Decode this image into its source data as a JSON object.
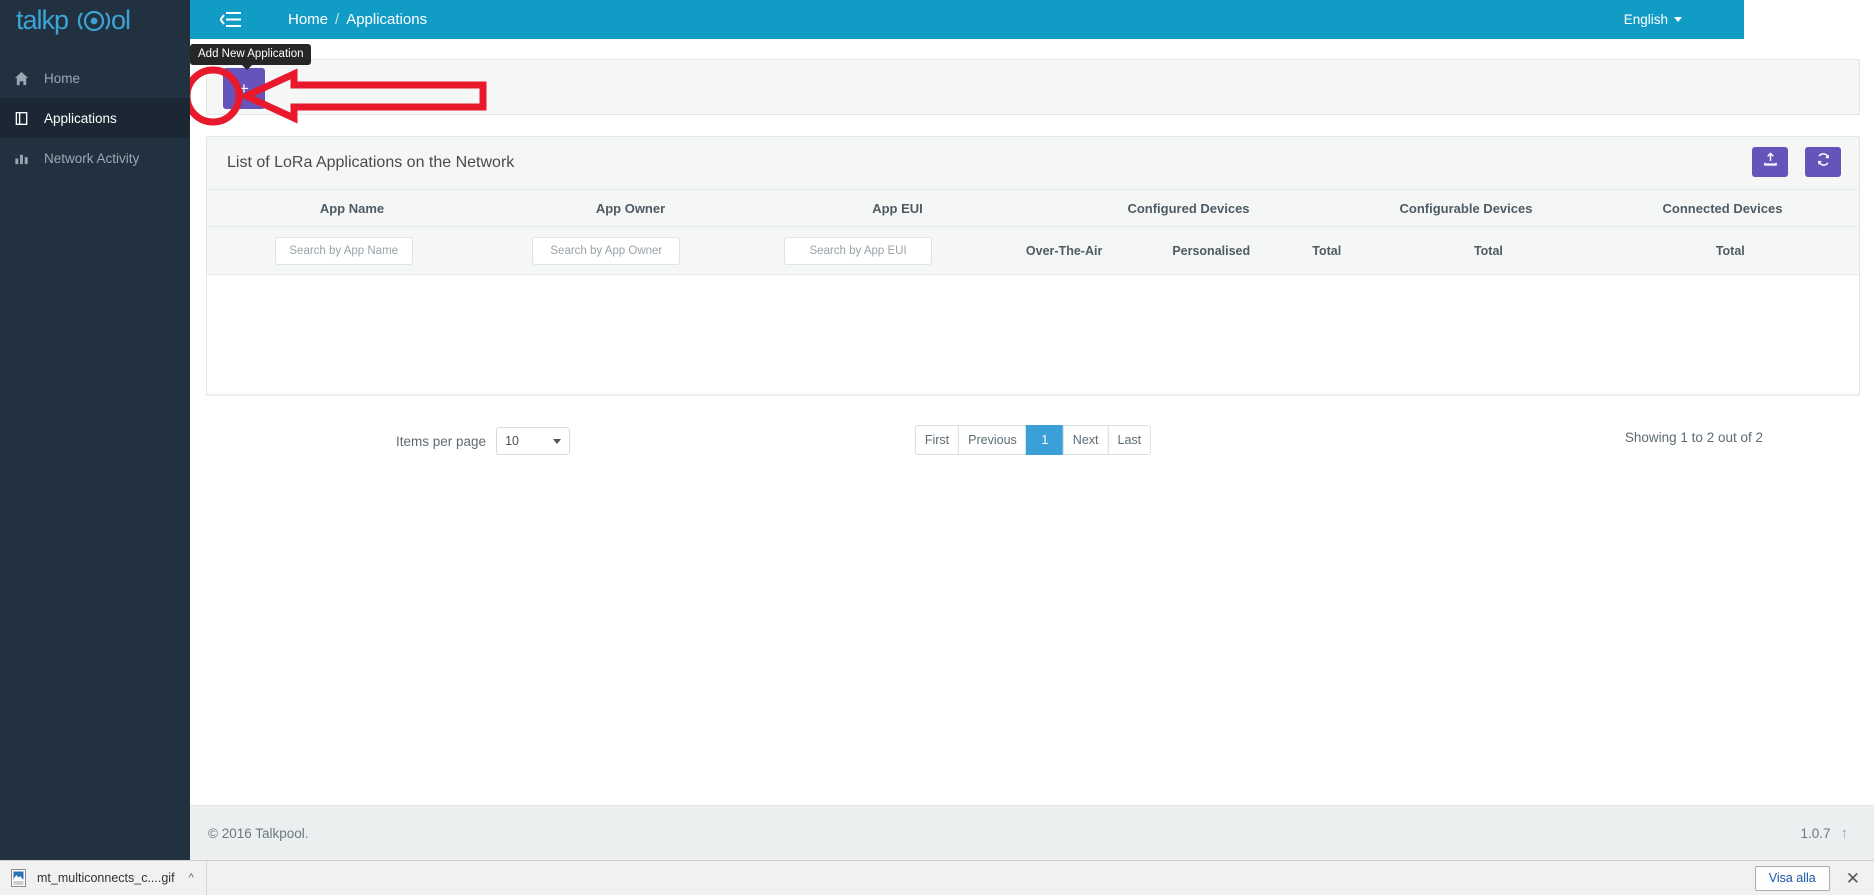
{
  "sidebar": {
    "brand": "talkpool",
    "items": [
      {
        "label": "Home",
        "icon": "home-icon",
        "active": false
      },
      {
        "label": "Applications",
        "icon": "book-icon",
        "active": true
      },
      {
        "label": "Network Activity",
        "icon": "bar-chart-icon",
        "active": false
      }
    ]
  },
  "topbar": {
    "menu_icon": "hamburger-menu-icon",
    "breadcrumb": {
      "home": "Home",
      "separator": "/",
      "current": "Applications"
    },
    "language": "English"
  },
  "toolbar": {
    "tooltip": "Add New Application",
    "add_label": "+"
  },
  "panel": {
    "title": "List of LoRa Applications on the Network",
    "export_icon": "export-icon",
    "refresh_icon": "refresh-icon"
  },
  "table": {
    "columns": [
      "App Name",
      "App Owner",
      "App EUI",
      "Configured Devices",
      "Configurable Devices",
      "Connected Devices"
    ],
    "subheaders": [
      "",
      "",
      "",
      "Over-The-Air",
      "Personalised",
      "Total",
      "Total",
      "Total"
    ],
    "search_placeholders": [
      "Search by App Name",
      "Search by App Owner",
      "Search by App EUI"
    ],
    "rows": []
  },
  "pager": {
    "items_per_page_label": "Items per page",
    "items_per_page_value": "10",
    "buttons": [
      "First",
      "Previous",
      "1",
      "Next",
      "Last"
    ],
    "active_page": "1",
    "showing": "Showing 1 to 2 out of 2"
  },
  "footer": {
    "copyright": "© 2016 Talkpool.",
    "version": "1.0.7",
    "scroll_top_icon": "arrow-up-icon"
  },
  "downloads": {
    "file_name": "mt_multiconnects_c....gif",
    "file_icon": "image-file-icon",
    "chevron_icon": "chevron-up-icon",
    "show_all_label": "Visa alla",
    "close_icon": "close-icon"
  },
  "annotation": {
    "color": "#e8192c",
    "shapes": [
      "circle-highlight",
      "left-arrow"
    ]
  },
  "colors": {
    "sidebar_bg": "#22313f",
    "topbar_bg": "#119cc6",
    "accent_purple": "#6654ba",
    "accent_blue": "#3ca0d8",
    "annotation_red": "#e8192c"
  }
}
